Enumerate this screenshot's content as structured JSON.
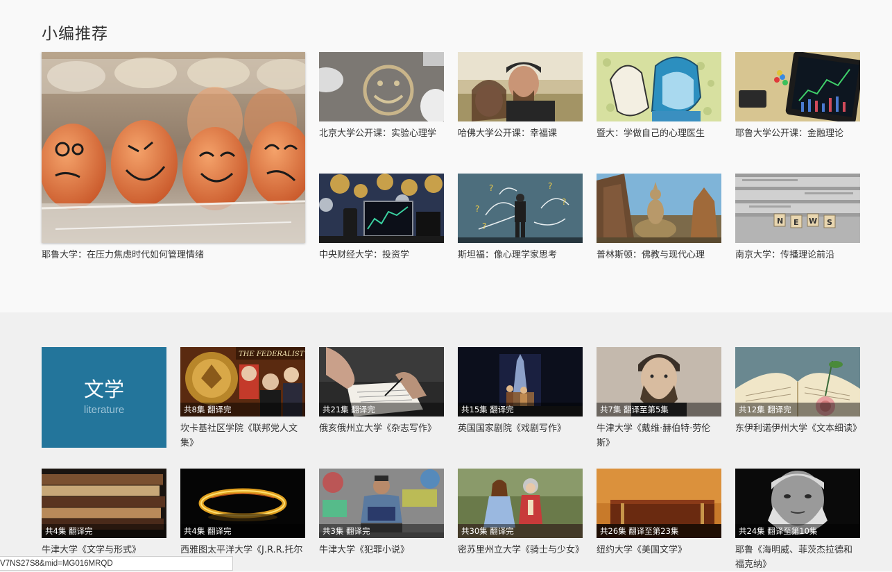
{
  "section_title": "小编推荐",
  "featured": {
    "caption": "耶鲁大学：在压力焦虑时代如何管理情绪",
    "image": "eggs-with-faces"
  },
  "recommended": [
    {
      "caption": "北京大学公开课：实验心理学",
      "image": "smiley-chalk"
    },
    {
      "caption": "哈佛大学公开课：幸福课",
      "image": "father-daughter"
    },
    {
      "caption": "暨大：学做自己的心理医生",
      "image": "mask-illustration"
    },
    {
      "caption": "耶鲁大学公开课：金融理论",
      "image": "tablet-chart"
    },
    {
      "caption": "中央财经大学：投资学",
      "image": "bitcoin-trading"
    },
    {
      "caption": "斯坦福：像心理学家思考",
      "image": "question-marks"
    },
    {
      "caption": "普林斯顿：佛教与现代心理",
      "image": "buddha-statue"
    },
    {
      "caption": "南京大学：传播理论前沿",
      "image": "news-tiles"
    }
  ],
  "category": {
    "name": "文学",
    "subtitle": "literature"
  },
  "literature_courses": [
    {
      "caption": "坎卡基社区学院《联邦党人文集》",
      "episodes": "共8集 翻译完",
      "image": "federalist-papers"
    },
    {
      "caption": "俄亥俄州立大学《杂志写作》",
      "episodes": "共21集 翻译完",
      "image": "writing-hand"
    },
    {
      "caption": "英国国家剧院《戏剧写作》",
      "episodes": "共15集 翻译完",
      "image": "stage"
    },
    {
      "caption": "牛津大学《戴维·赫伯特·劳伦斯》",
      "episodes": "共7集 翻译至第5集",
      "image": "portrait-man"
    },
    {
      "caption": "东伊利诺伊州大学《文本细读》",
      "episodes": "共12集 翻译完",
      "image": "book-rose"
    },
    {
      "caption": "牛津大学《文学与形式》",
      "episodes": "共4集 翻译完",
      "image": "old-books"
    },
    {
      "caption": "西雅图太平洋大学《J.R.R.托尔金》",
      "episodes": "共4集 翻译完",
      "image": "golden-ring"
    },
    {
      "caption": "牛津大学《犯罪小说》",
      "episodes": "共3集 翻译完",
      "image": "reader-graffiti"
    },
    {
      "caption": "密苏里州立大学《骑士与少女》",
      "episodes": "共30集 翻译完",
      "image": "kids-costume"
    },
    {
      "caption": "纽约大学《美国文学》",
      "episodes": "共26集 翻译至第23集",
      "image": "leather-book"
    },
    {
      "caption": "耶鲁《海明威、菲茨杰拉德和福克纳》",
      "episodes": "共24集 翻译至第10集",
      "image": "hemingway"
    }
  ],
  "status_bar": "V7NS27S8&mid=MG016MRQD"
}
